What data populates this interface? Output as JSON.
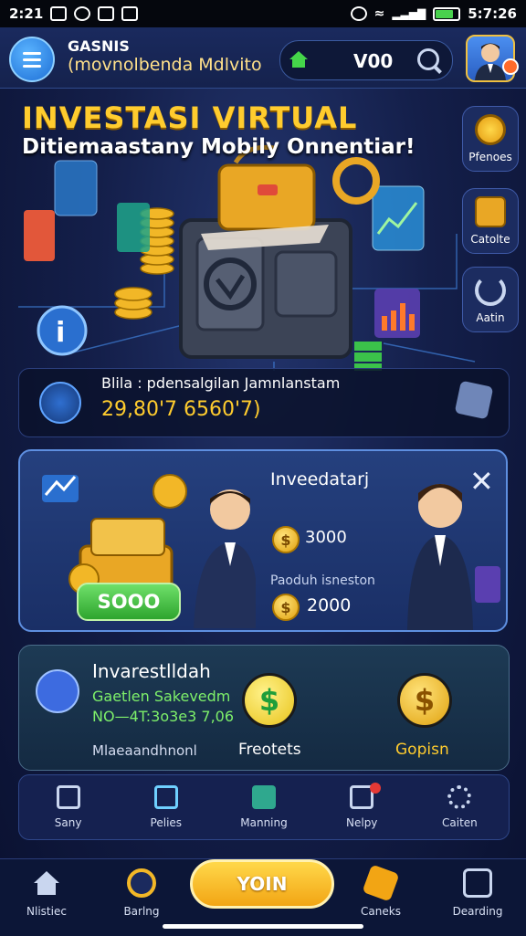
{
  "status_bar": {
    "time_left": "2:21",
    "time_right": "5:7:26"
  },
  "header": {
    "title": "GASNIS",
    "subtitle": "(movnolbenda Mdlvito",
    "search_value": "V00"
  },
  "hero": {
    "title": "INVESTASI VIRTUAL",
    "subtitle": "Ditiemaastany Mobily Onnentiar!",
    "side_buttons": [
      {
        "label": "Pfenoes"
      },
      {
        "label": "Catolte"
      },
      {
        "label": "Aatin"
      }
    ]
  },
  "stat": {
    "label": "Blila : pdensalgilan Jamnlanstam",
    "value": "29,80'7 6560'7)"
  },
  "invest_card": {
    "title": "Inveedatarj",
    "amount1": "3000",
    "label2": "Paoduh isneston",
    "amount2": "2000",
    "button": "SOOO"
  },
  "profit_card": {
    "title": "Invarestlldah",
    "line1": "Gaetlen Sakevedm",
    "line2": "NO—4T:3o3e3 7,06",
    "line3": "Mlaeaandhnonl",
    "coin1_label": "Freotets",
    "coin2_label": "Gopisn"
  },
  "mini_nav": [
    {
      "label": "Sany"
    },
    {
      "label": "Pelies"
    },
    {
      "label": "Manning"
    },
    {
      "label": "Nelpy"
    },
    {
      "label": "Caiten"
    }
  ],
  "bottom_nav": {
    "items": [
      {
        "label": "Nlistiec"
      },
      {
        "label": "Barlng"
      },
      {
        "label": "Caneks"
      },
      {
        "label": "Dearding"
      }
    ],
    "main_button": "YOIN"
  },
  "colors": {
    "accent": "#ffcc2e",
    "positive": "#7ef06a",
    "primary": "#1e6fd6"
  }
}
